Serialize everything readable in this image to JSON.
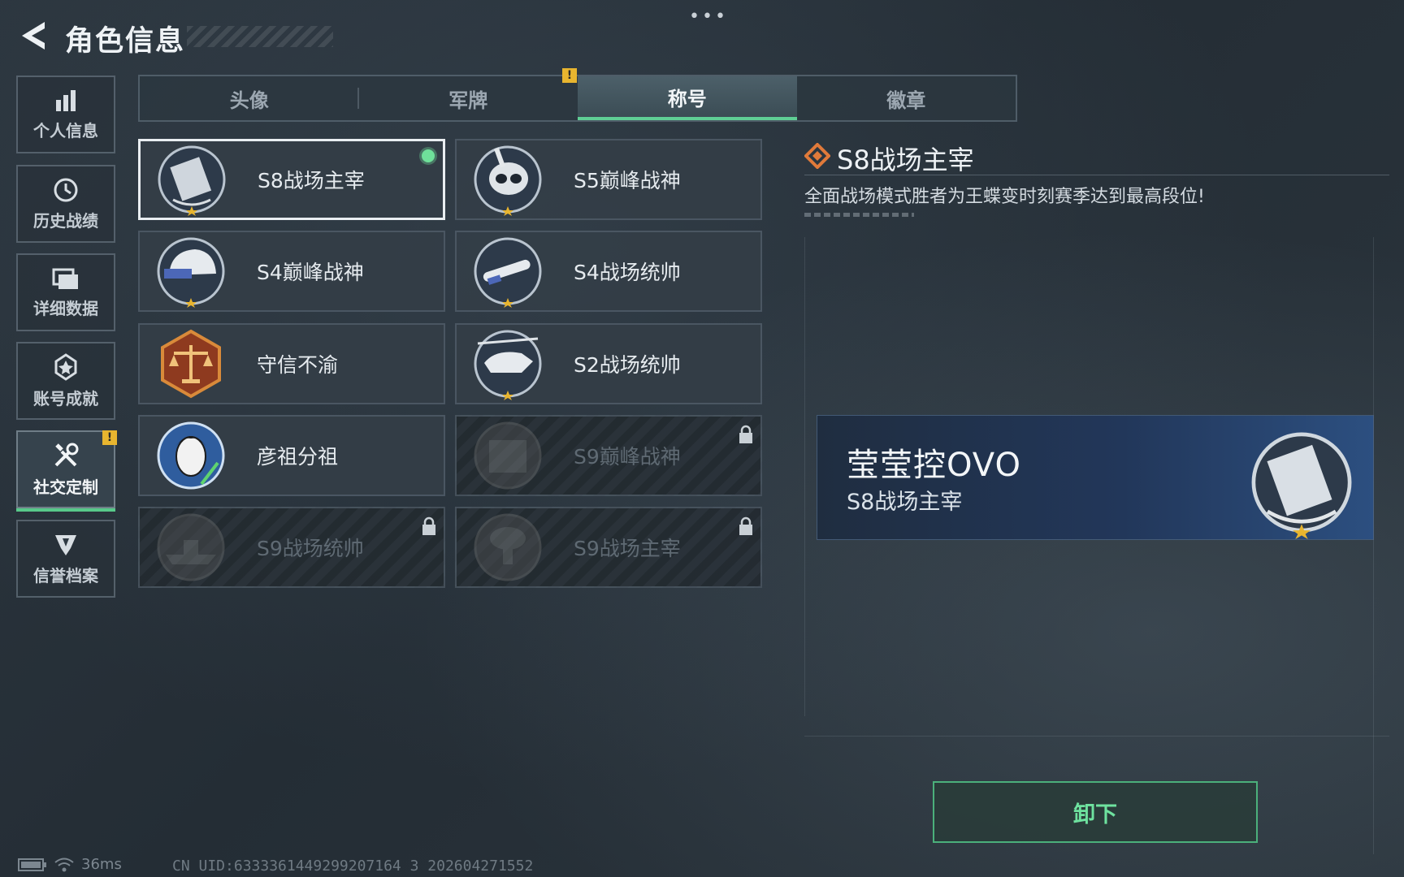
{
  "header": {
    "title": "角色信息",
    "more": "•••"
  },
  "sidebar": {
    "items": [
      {
        "label": "个人信息",
        "icon": "bar-chart-icon"
      },
      {
        "label": "历史战绩",
        "icon": "clock-icon"
      },
      {
        "label": "详细数据",
        "icon": "folder-icon"
      },
      {
        "label": "账号成就",
        "icon": "achievement-icon"
      },
      {
        "label": "社交定制",
        "icon": "tools-icon",
        "active": true,
        "alert": "!"
      },
      {
        "label": "信誉档案",
        "icon": "shield-icon"
      }
    ]
  },
  "tabs": [
    {
      "label": "头像"
    },
    {
      "label": "军牌",
      "alert": "!"
    },
    {
      "label": "称号",
      "active": true
    },
    {
      "label": "徽章"
    }
  ],
  "titles": [
    {
      "name": "S8战场主宰",
      "equipped": true,
      "locked": false
    },
    {
      "name": "S5巅峰战神",
      "locked": false
    },
    {
      "name": "S4巅峰战神",
      "locked": false
    },
    {
      "name": "S4战场统帅",
      "locked": false
    },
    {
      "name": "守信不渝",
      "locked": false
    },
    {
      "name": "S2战场统帅",
      "locked": false
    },
    {
      "name": "彦祖分祖",
      "locked": false
    },
    {
      "name": "S9巅峰战神",
      "locked": true
    },
    {
      "name": "S9战场统帅",
      "locked": true
    },
    {
      "name": "S9战场主宰",
      "locked": true
    }
  ],
  "detail": {
    "title": "S8战场主宰",
    "description": "全面战场模式胜者为王蝶变时刻赛季达到最高段位!"
  },
  "preview": {
    "player_name": "莹莹控OVO",
    "title": "S8战场主宰"
  },
  "actions": {
    "unequip": "卸下"
  },
  "status": {
    "ping": "36ms",
    "uid": "CN UID:6333361449299207164 3 202604271552"
  },
  "colors": {
    "accent_green": "#5fcf95",
    "alert_yellow": "#e8b52f",
    "preview_blue": "#2c4f80"
  }
}
